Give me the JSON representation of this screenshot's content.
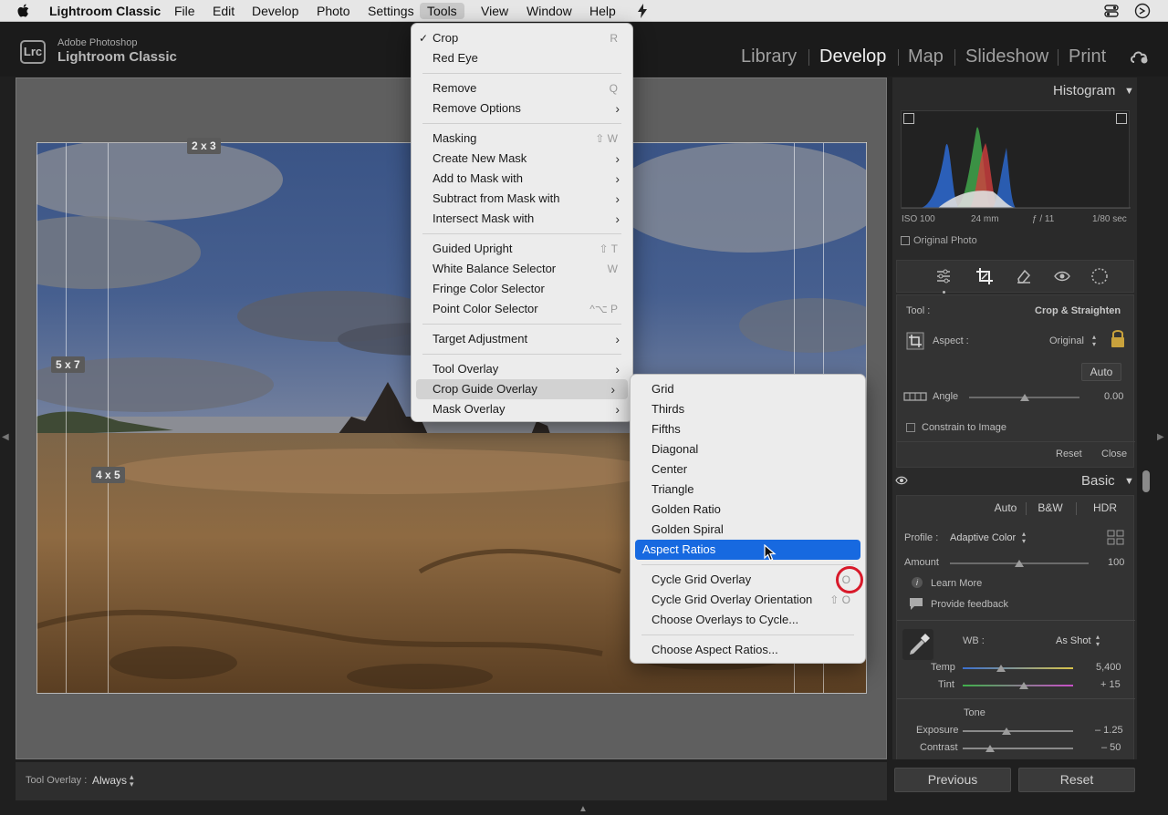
{
  "menubar": {
    "app_name": "Lightroom Classic",
    "items": [
      "File",
      "Edit",
      "Develop",
      "Photo",
      "Settings",
      "Tools",
      "View",
      "Window",
      "Help"
    ],
    "active": "Tools"
  },
  "header": {
    "badge": "Lrc",
    "brand_line1": "Adobe Photoshop",
    "brand_line2": "Lightroom Classic",
    "modules": [
      "Library",
      "Develop",
      "Map",
      "Slideshow",
      "Print"
    ],
    "active_module": "Develop"
  },
  "crop_overlay": {
    "labels": [
      "2 x 3",
      "5 x 7",
      "4 x 5"
    ]
  },
  "bottom_toolbar": {
    "tool_overlay_label": "Tool Overlay :",
    "tool_overlay_value": "Always"
  },
  "tools_menu": {
    "items": [
      {
        "label": "Crop",
        "shortcut": "R",
        "checked": true
      },
      {
        "label": "Red Eye"
      },
      {
        "sep": true
      },
      {
        "label": "Remove",
        "shortcut": "Q"
      },
      {
        "label": "Remove Options",
        "submenu": true
      },
      {
        "sep": true
      },
      {
        "label": "Masking",
        "shortcut": "⇧ W"
      },
      {
        "label": "Create New Mask",
        "submenu": true
      },
      {
        "label": "Add to Mask with",
        "submenu": true
      },
      {
        "label": "Subtract from Mask with",
        "submenu": true
      },
      {
        "label": "Intersect Mask with",
        "submenu": true
      },
      {
        "sep": true
      },
      {
        "label": "Guided Upright",
        "shortcut": "⇧ T"
      },
      {
        "label": "White Balance Selector",
        "shortcut": "W"
      },
      {
        "label": "Fringe Color Selector"
      },
      {
        "label": "Point Color Selector",
        "shortcut": "^⌥ P"
      },
      {
        "sep": true
      },
      {
        "label": "Target Adjustment",
        "submenu": true
      },
      {
        "sep": true
      },
      {
        "label": "Tool Overlay",
        "submenu": true
      },
      {
        "label": "Crop Guide Overlay",
        "submenu": true,
        "hover": true
      },
      {
        "label": "Mask Overlay",
        "submenu": true
      }
    ]
  },
  "crop_guide_submenu": {
    "items": [
      {
        "label": "Grid"
      },
      {
        "label": "Thirds"
      },
      {
        "label": "Fifths"
      },
      {
        "label": "Diagonal"
      },
      {
        "label": "Center"
      },
      {
        "label": "Triangle"
      },
      {
        "label": "Golden Ratio"
      },
      {
        "label": "Golden Spiral"
      },
      {
        "label": "Aspect Ratios",
        "highlighted": true
      },
      {
        "sep": true
      },
      {
        "label": "Cycle Grid Overlay",
        "shortcut": "O",
        "circled": true
      },
      {
        "label": "Cycle Grid Overlay Orientation",
        "shortcut": "⇧ O"
      },
      {
        "label": "Choose Overlays to Cycle..."
      },
      {
        "sep": true
      },
      {
        "label": "Choose Aspect Ratios..."
      }
    ]
  },
  "histogram": {
    "title": "Histogram",
    "iso": "ISO 100",
    "focal": "24 mm",
    "aperture": "ƒ / 11",
    "shutter": "1/80 sec",
    "original_photo": "Original Photo"
  },
  "crop_panel": {
    "tool_label": "Tool :",
    "tool_value": "Crop & Straighten",
    "aspect_label": "Aspect :",
    "aspect_value": "Original",
    "auto": "Auto",
    "angle_label": "Angle",
    "angle_value": "0.00",
    "angle_fraction": 0.5,
    "constrain": "Constrain to Image",
    "reset": "Reset",
    "close": "Close"
  },
  "basic_panel": {
    "title": "Basic",
    "auto": "Auto",
    "bw": "B&W",
    "hdr": "HDR",
    "profile_label": "Profile :",
    "profile_value": "Adaptive Color",
    "amount_label": "Amount",
    "amount_value": "100",
    "amount_fraction": 0.5,
    "learn_more": "Learn More",
    "feedback": "Provide feedback",
    "wb_label": "WB :",
    "wb_value": "As Shot",
    "temp_label": "Temp",
    "temp_value": "5,400",
    "temp_fraction": 0.35,
    "tint_label": "Tint",
    "tint_value": "+ 15",
    "tint_fraction": 0.55,
    "tone_label": "Tone",
    "exposure_label": "Exposure",
    "exposure_value": "– 1.25",
    "exposure_fraction": 0.4,
    "contrast_label": "Contrast",
    "contrast_value": "– 50",
    "contrast_fraction": 0.25
  },
  "footer": {
    "previous": "Previous",
    "reset": "Reset"
  }
}
